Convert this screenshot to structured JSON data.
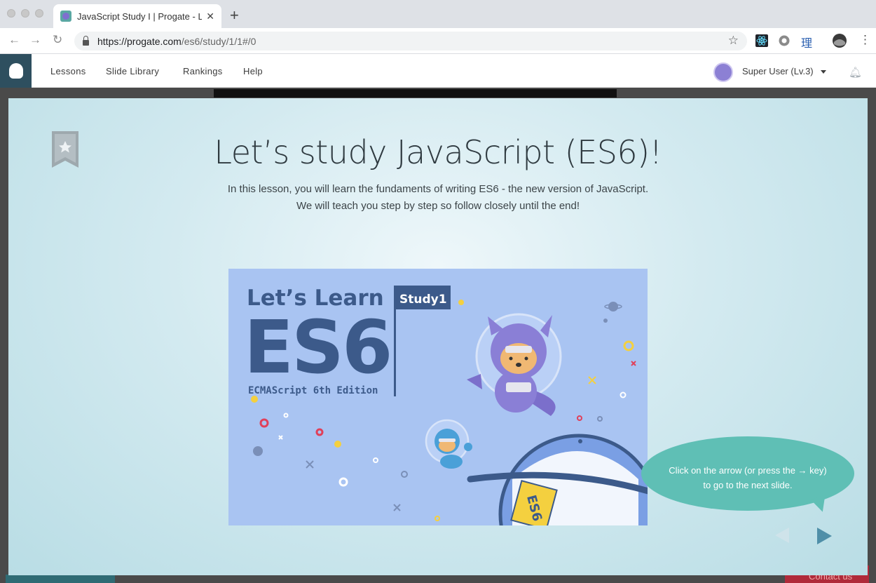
{
  "browser": {
    "tab_title": "JavaScript Study I | Progate - L",
    "tab_close": "✕",
    "new_tab": "+",
    "url_host": "https://progate.com",
    "url_path": "/es6/study/1/1#/0",
    "ext_letter": "理"
  },
  "nav": {
    "links": [
      "Lessons",
      "Slide Library",
      "Rankings",
      "Help"
    ],
    "user_name": "Super User (Lv.3)",
    "bell_icon": "bell-icon"
  },
  "lesson": {
    "title": "Let’s study JavaScript (ES6)!",
    "description_line1": "In this lesson, you will learn the fundaments of writing ES6 - the new version of JavaScript.",
    "description_line2": "We will teach you step by step so follow closely until the end!"
  },
  "slide": {
    "heading_small": "Let’s  Learn",
    "heading_big": "ES6",
    "subtitle": "ECMAScript 6th Edition",
    "flag_label": "Study1",
    "planet_label": "ES6",
    "background_color": "#a9c4f2",
    "accent_color": "#3c5a8a"
  },
  "hint": {
    "line1": "Click on the arrow (or press the → key)",
    "line2": "to go to the next slide.",
    "color": "#5fbfb5"
  },
  "footer": {
    "contact_label": "Contact us"
  }
}
